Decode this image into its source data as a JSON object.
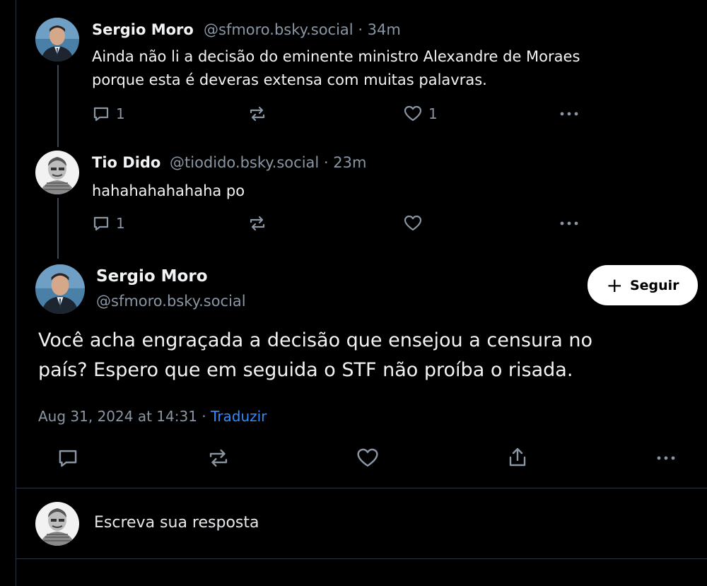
{
  "thread": [
    {
      "author_name": "Sergio Moro",
      "handle": "@sfmoro.bsky.social",
      "time": "· 34m",
      "text_line1": "Ainda não li a decisão do eminente ministro Alexandre de Moraes",
      "text_line2": "porque esta é deveras extensa com muitas palavras.",
      "reply_count": "1",
      "repost_count": "",
      "like_count": "1"
    },
    {
      "author_name": "Tio Dido",
      "handle": "@tiodido.bsky.social",
      "time": "· 23m",
      "text_line1": "hahahahahahaha po",
      "reply_count": "1",
      "repost_count": "",
      "like_count": ""
    }
  ],
  "main_post": {
    "author_name": "Sergio Moro",
    "handle": "@sfmoro.bsky.social",
    "follow_label": "Seguir",
    "text_line1": "Você acha engraçada a decisão que ensejou a censura no",
    "text_line2": "país? Espero que em seguida o STF não proíba o risada.",
    "timestamp": "Aug 31, 2024 at 14:31 · ",
    "translate_label": "Traduzir"
  },
  "composer": {
    "placeholder": "Escreva sua resposta"
  },
  "icons": {
    "reply": "reply-icon",
    "repost": "repost-icon",
    "like": "heart-icon",
    "share": "share-icon",
    "more": "more-icon"
  },
  "colors": {
    "background": "#000000",
    "link": "#2f8bff",
    "muted": "#8a96a3",
    "divider": "#2b3440"
  }
}
